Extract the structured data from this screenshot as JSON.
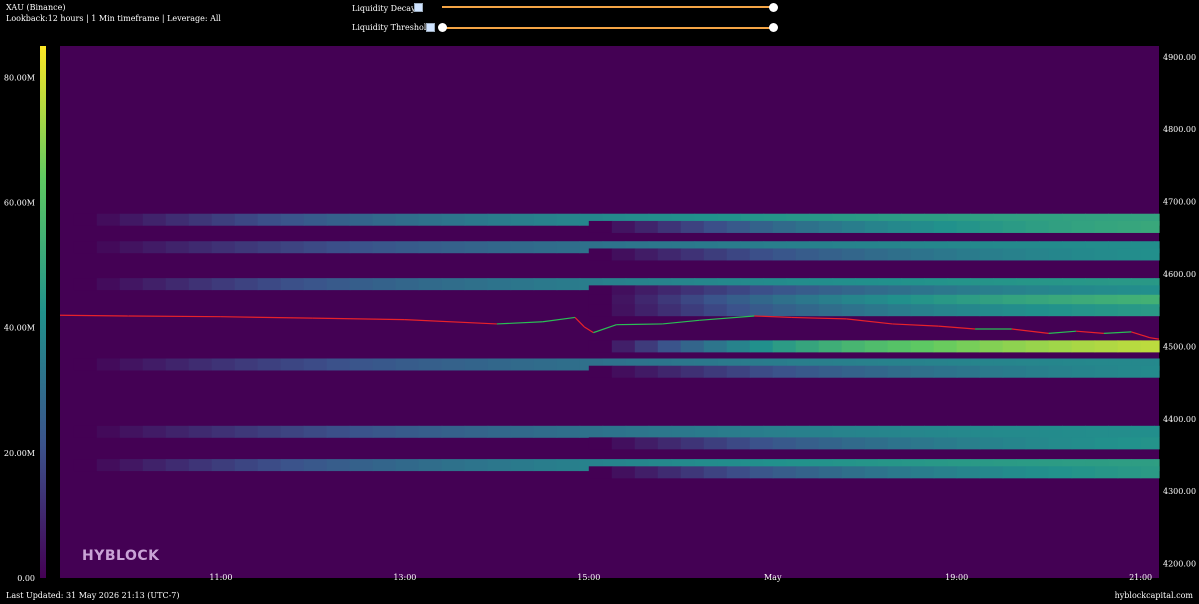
{
  "header": {
    "title": "XAU (Binance)",
    "subtitle": "Lookback:12 hours | 1 Min timeframe | Leverage: All"
  },
  "controls": {
    "decay": {
      "label": "Liquidity Decay",
      "icon": "image-icon",
      "value": 1.0
    },
    "threshold": {
      "label": "Liquidity Threshold",
      "icon": "image-icon",
      "value_min": 0.0,
      "value_max": 1.0
    }
  },
  "footer": {
    "updated": "Last Updated: 31 May 2026 21:13 (UTC-7)",
    "site": "hyblockcapital.com"
  },
  "watermark": "HYBLOCK",
  "colors": {
    "background": "#440154",
    "price_down": "#e8222a",
    "price_up": "#2bbd55",
    "slider": "#f4a445"
  },
  "chart_data": {
    "type": "heatmap",
    "colorscale": "viridis",
    "x_ticks": [
      "11:00",
      "13:00",
      "15:00",
      "May",
      "19:00",
      "21:00"
    ],
    "x_tick_hours": [
      11,
      13,
      15,
      17,
      19,
      21
    ],
    "x_range_hours": [
      9.25,
      21.2
    ],
    "y_ticks": [
      "4200.00",
      "4300.00",
      "4400.00",
      "4500.00",
      "4600.00",
      "4700.00",
      "4800.00",
      "4900.00"
    ],
    "y_tick_values": [
      4200,
      4300,
      4400,
      4500,
      4600,
      4700,
      4800,
      4900
    ],
    "y_range": [
      4180,
      4915
    ],
    "colorbar_ticks": [
      "0.00",
      "20.00M",
      "40.00M",
      "60.00M",
      "80.00M"
    ],
    "colorbar_tick_values": [
      0,
      20,
      40,
      60,
      80
    ],
    "colorbar_range": [
      0,
      85
    ],
    "bands": [
      {
        "price": 4675,
        "start": 9.4,
        "peak": 52,
        "growth": 0.25
      },
      {
        "price": 4665,
        "start": 15.0,
        "peak": 58,
        "growth": 0.35
      },
      {
        "price": 4637,
        "start": 9.4,
        "peak": 45,
        "growth": 0.22
      },
      {
        "price": 4627,
        "start": 15.0,
        "peak": 50,
        "growth": 0.3
      },
      {
        "price": 4586,
        "start": 9.4,
        "peak": 48,
        "growth": 0.25
      },
      {
        "price": 4576,
        "start": 15.0,
        "peak": 50,
        "growth": 0.3
      },
      {
        "price": 4563,
        "start": 15.0,
        "peak": 62,
        "growth": 0.35
      },
      {
        "price": 4550,
        "start": 15.0,
        "peak": 52,
        "growth": 0.35
      },
      {
        "price": 4500,
        "start": 15.0,
        "peak": 84,
        "growth": 0.4
      },
      {
        "price": 4475,
        "start": 9.4,
        "peak": 42,
        "growth": 0.25
      },
      {
        "price": 4465,
        "start": 15.0,
        "peak": 48,
        "growth": 0.3
      },
      {
        "price": 4382,
        "start": 9.4,
        "peak": 45,
        "growth": 0.22
      },
      {
        "price": 4366,
        "start": 15.0,
        "peak": 52,
        "growth": 0.3
      },
      {
        "price": 4336,
        "start": 9.4,
        "peak": 50,
        "growth": 0.25
      },
      {
        "price": 4326,
        "start": 15.0,
        "peak": 55,
        "growth": 0.3
      }
    ],
    "price_series": {
      "x": [
        9.25,
        10.0,
        11.0,
        12.0,
        13.0,
        14.0,
        14.5,
        14.85,
        14.95,
        15.05,
        15.3,
        15.8,
        16.2,
        16.8,
        17.2,
        17.8,
        18.3,
        18.8,
        19.2,
        19.6,
        20.0,
        20.3,
        20.6,
        20.9,
        21.1,
        21.2
      ],
      "y": [
        4543,
        4542,
        4541,
        4539,
        4537,
        4531,
        4534,
        4540,
        4527,
        4519,
        4530,
        4531,
        4536,
        4542,
        4540,
        4538,
        4531,
        4528,
        4524,
        4524,
        4518,
        4521,
        4518,
        4520,
        4512,
        4510
      ]
    }
  }
}
